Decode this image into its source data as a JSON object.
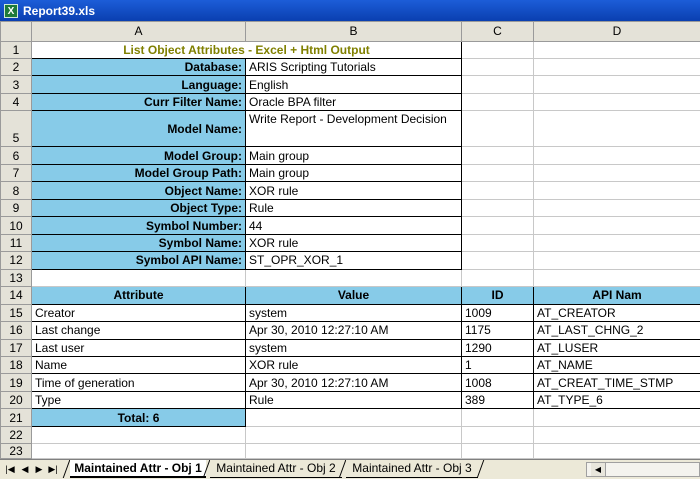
{
  "window": {
    "title": "Report39.xls",
    "icon": "excel-icon"
  },
  "columns": [
    "A",
    "B",
    "C",
    "D"
  ],
  "report": {
    "title": "List Object Attributes - Excel + Html Output"
  },
  "info": [
    {
      "label": "Database:",
      "value": "ARIS Scripting Tutorials"
    },
    {
      "label": "Language:",
      "value": "English"
    },
    {
      "label": "Curr Filter Name:",
      "value": "Oracle BPA filter"
    },
    {
      "label": "Model Name:",
      "value": "Write Report - Development Decision"
    },
    {
      "label": "Model Group:",
      "value": "Main group"
    },
    {
      "label": "Model Group Path:",
      "value": "Main group"
    },
    {
      "label": "Object Name:",
      "value": "XOR rule"
    },
    {
      "label": "Object Type:",
      "value": "Rule"
    },
    {
      "label": "Symbol Number:",
      "value": "44"
    },
    {
      "label": "Symbol Name:",
      "value": "XOR rule"
    },
    {
      "label": "Symbol API Name:",
      "value": "ST_OPR_XOR_1"
    }
  ],
  "table": {
    "headers": [
      "Attribute",
      "Value",
      "ID",
      "API Nam"
    ],
    "rows": [
      {
        "attribute": "Creator",
        "value": "system",
        "id": "1009",
        "api": "AT_CREATOR"
      },
      {
        "attribute": "Last change",
        "value": "Apr 30, 2010 12:27:10 AM",
        "id": "1175",
        "api": "AT_LAST_CHNG_2"
      },
      {
        "attribute": "Last user",
        "value": "system",
        "id": "1290",
        "api": "AT_LUSER"
      },
      {
        "attribute": "Name",
        "value": "XOR rule",
        "id": "1",
        "api": "AT_NAME"
      },
      {
        "attribute": "Time of generation",
        "value": "Apr 30, 2010 12:27:10 AM",
        "id": "1008",
        "api": "AT_CREAT_TIME_STMP"
      },
      {
        "attribute": "Type",
        "value": "Rule",
        "id": "389",
        "api": "AT_TYPE_6"
      }
    ],
    "total": "Total: 6"
  },
  "row_numbers": [
    "1",
    "2",
    "3",
    "4",
    "5",
    "6",
    "7",
    "8",
    "9",
    "10",
    "11",
    "12",
    "13",
    "14",
    "15",
    "16",
    "17",
    "18",
    "19",
    "20",
    "21",
    "22",
    "23"
  ],
  "sheet_tabs": [
    {
      "label": "Maintained Attr - Obj 1",
      "active": true
    },
    {
      "label": "Maintained Attr - Obj 2",
      "active": false
    },
    {
      "label": "Maintained Attr - Obj 3",
      "active": false
    }
  ],
  "nav_icons": [
    "first-sheet-icon",
    "prev-sheet-icon",
    "next-sheet-icon",
    "last-sheet-icon"
  ]
}
